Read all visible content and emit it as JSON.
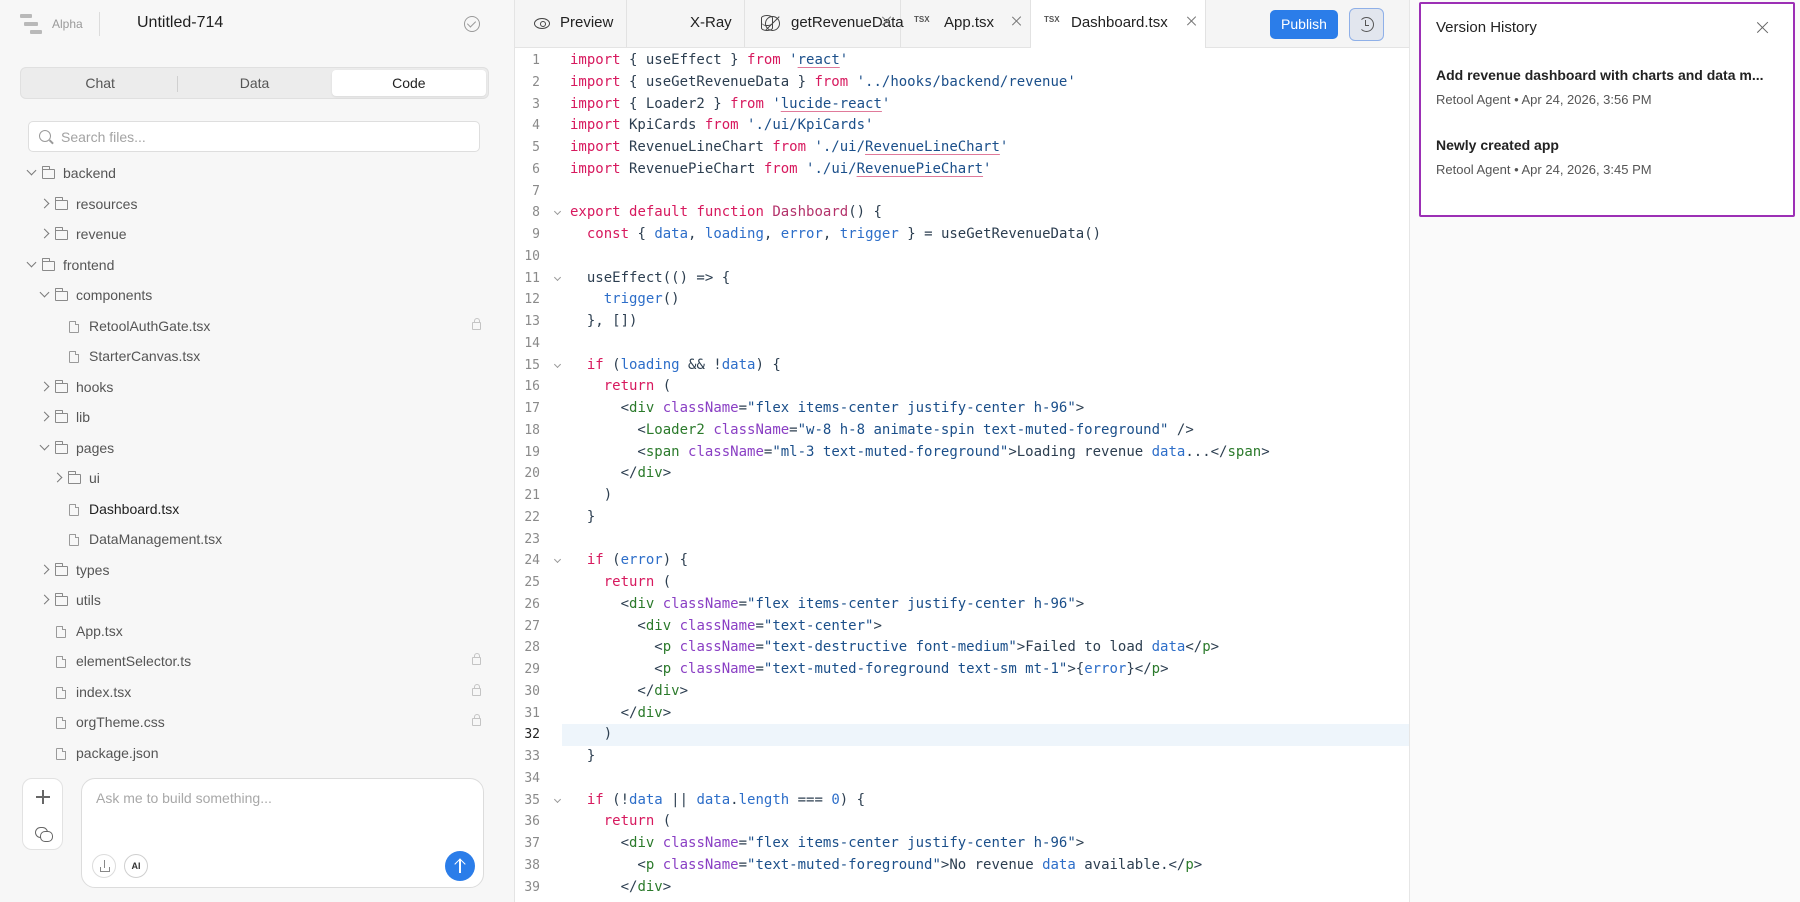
{
  "app": {
    "brand": "Alpha",
    "title": "Untitled-714"
  },
  "mode_tabs": [
    {
      "label": "Chat",
      "active": false
    },
    {
      "label": "Data",
      "active": false
    },
    {
      "label": "Code",
      "active": true
    }
  ],
  "search": {
    "placeholder": "Search files..."
  },
  "tree": [
    {
      "label": "backend",
      "depth": 0,
      "kind": "folder",
      "open": true
    },
    {
      "label": "resources",
      "depth": 1,
      "kind": "folder",
      "open": false
    },
    {
      "label": "revenue",
      "depth": 1,
      "kind": "folder",
      "open": false
    },
    {
      "label": "frontend",
      "depth": 0,
      "kind": "folder",
      "open": true
    },
    {
      "label": "components",
      "depth": 1,
      "kind": "folder",
      "open": true
    },
    {
      "label": "RetoolAuthGate.tsx",
      "depth": 2,
      "kind": "file",
      "locked": true
    },
    {
      "label": "StarterCanvas.tsx",
      "depth": 2,
      "kind": "file"
    },
    {
      "label": "hooks",
      "depth": 1,
      "kind": "folder",
      "open": false
    },
    {
      "label": "lib",
      "depth": 1,
      "kind": "folder",
      "open": false
    },
    {
      "label": "pages",
      "depth": 1,
      "kind": "folder",
      "open": true
    },
    {
      "label": "ui",
      "depth": 2,
      "kind": "folder",
      "open": false
    },
    {
      "label": "Dashboard.tsx",
      "depth": 2,
      "kind": "file",
      "active": true
    },
    {
      "label": "DataManagement.tsx",
      "depth": 2,
      "kind": "file"
    },
    {
      "label": "types",
      "depth": 1,
      "kind": "folder",
      "open": false
    },
    {
      "label": "utils",
      "depth": 1,
      "kind": "folder",
      "open": false
    },
    {
      "label": "App.tsx",
      "depth": 1,
      "kind": "file"
    },
    {
      "label": "elementSelector.ts",
      "depth": 1,
      "kind": "file",
      "locked": true
    },
    {
      "label": "index.tsx",
      "depth": 1,
      "kind": "file",
      "locked": true
    },
    {
      "label": "orgTheme.css",
      "depth": 1,
      "kind": "file",
      "locked": true
    },
    {
      "label": "package.json",
      "depth": 1,
      "kind": "file"
    }
  ],
  "prompt": {
    "placeholder": "Ask me to build something...",
    "model_badge": "AI"
  },
  "editor_tabs": [
    {
      "label": "Preview",
      "icon": "eye-icon",
      "closable": false
    },
    {
      "label": "X-Ray",
      "icon": "crosshair-icon",
      "closable": false
    },
    {
      "label": "getRevenueData",
      "icon": "database-icon",
      "closable": true
    },
    {
      "label": "App.tsx",
      "icon": "tsx-file-icon",
      "closable": true
    },
    {
      "label": "Dashboard.tsx",
      "icon": "tsx-file-icon",
      "closable": true,
      "active": true
    }
  ],
  "toolbar": {
    "publish_label": "Publish"
  },
  "code": {
    "current_line": 32,
    "lines": [
      "import { useEffect } from 'react'",
      "import { useGetRevenueData } from '../hooks/backend/revenue'",
      "import { Loader2 } from 'lucide-react'",
      "import KpiCards from './ui/KpiCards'",
      "import RevenueLineChart from './ui/RevenueLineChart'",
      "import RevenuePieChart from './ui/RevenuePieChart'",
      "",
      "export default function Dashboard() {",
      "  const { data, loading, error, trigger } = useGetRevenueData()",
      "",
      "  useEffect(() => {",
      "    trigger()",
      "  }, [])",
      "",
      "  if (loading && !data) {",
      "    return (",
      "      <div className=\"flex items-center justify-center h-96\">",
      "        <Loader2 className=\"w-8 h-8 animate-spin text-muted-foreground\" />",
      "        <span className=\"ml-3 text-muted-foreground\">Loading revenue data...</span>",
      "      </div>",
      "    )",
      "  }",
      "",
      "  if (error) {",
      "    return (",
      "      <div className=\"flex items-center justify-center h-96\">",
      "        <div className=\"text-center\">",
      "          <p className=\"text-destructive font-medium\">Failed to load data</p>",
      "          <p className=\"text-muted-foreground text-sm mt-1\">{error}</p>",
      "        </div>",
      "      </div>",
      "    )",
      "  }",
      "",
      "  if (!data || data.length === 0) {",
      "    return (",
      "      <div className=\"flex items-center justify-center h-96\">",
      "        <p className=\"text-muted-foreground\">No revenue data available.</p>",
      "      </div>"
    ],
    "fold_lines": [
      8,
      11,
      15,
      24,
      35
    ]
  },
  "version_history": {
    "title": "Version History",
    "items": [
      {
        "title": "Add revenue dashboard with charts and data m...",
        "author": "Retool Agent",
        "date": "Apr 24, 2026, 3:56 PM"
      },
      {
        "title": "Newly created app",
        "author": "Retool Agent",
        "date": "Apr 24, 2026, 3:45 PM"
      }
    ]
  },
  "colors": {
    "accent": "#2b7de9",
    "history_border": "#9c2fb5"
  }
}
